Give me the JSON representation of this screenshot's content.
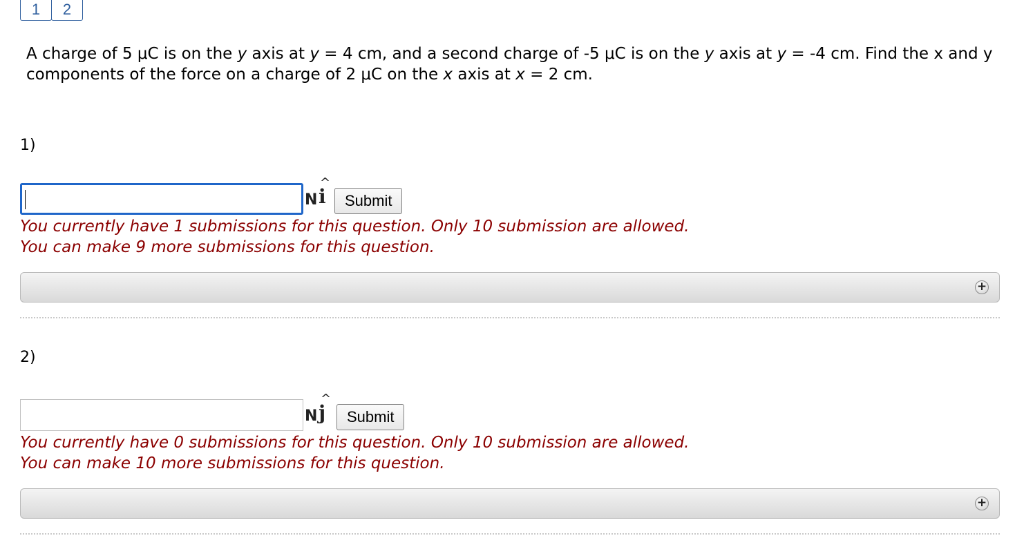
{
  "tabs": [
    "1",
    "2"
  ],
  "problem": {
    "p1": "A charge of 5 μC is on the ",
    "y1": "y",
    "p2": " axis at ",
    "y2": "y",
    "p3": " = 4 cm, and a second charge of -5 μC is on the ",
    "y3": "y",
    "p4": " axis at ",
    "y4": "y",
    "p5": " = -4 cm. Find the x and y components of the force on a charge of 2 μC on the ",
    "x1": "x",
    "p6": " axis at ",
    "x2": "x",
    "p7": " = 2 cm."
  },
  "questions": [
    {
      "number": "1)",
      "value": "",
      "unit": "N",
      "vector": "i",
      "hat": "^",
      "submit_label": "Submit",
      "message_line1": "You currently have 1 submissions for this question. Only 10 submission are allowed.",
      "message_line2": "You can make 9 more submissions for this question.",
      "expand_icon": "plus-circle-icon"
    },
    {
      "number": "2)",
      "value": "",
      "unit": "N",
      "vector": "j",
      "hat": "^",
      "submit_label": "Submit",
      "message_line1": "You currently have 0 submissions for this question. Only 10 submission are allowed.",
      "message_line2": "You can make 10 more submissions for this question.",
      "expand_icon": "plus-circle-icon"
    }
  ],
  "colors": {
    "message": "#8b0000",
    "focus_border": "#1f66c9",
    "tab_border": "#2f5f9e"
  }
}
